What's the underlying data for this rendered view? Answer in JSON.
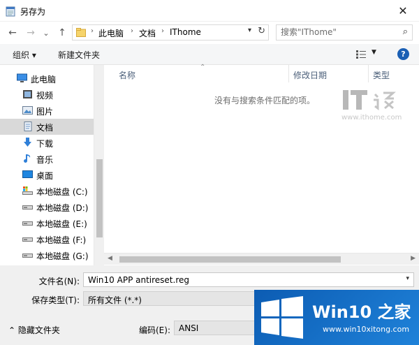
{
  "window": {
    "title": "另存为",
    "close_glyph": "✕"
  },
  "nav_buttons": {
    "back": "←",
    "forward": "→",
    "history": "⌄",
    "up": "↑"
  },
  "address": {
    "crumbs": [
      "此电脑",
      "文档",
      "IThome"
    ],
    "separator": "›",
    "refresh_glyph": "↻"
  },
  "search": {
    "placeholder": "搜索\"IThome\""
  },
  "toolbar": {
    "organize": "组织 ▾",
    "new_folder": "新建文件夹",
    "help": "?"
  },
  "nav_pane": {
    "items": [
      {
        "label": "此电脑",
        "icon": "computer-icon"
      },
      {
        "label": "视频",
        "icon": "video-icon"
      },
      {
        "label": "图片",
        "icon": "picture-icon"
      },
      {
        "label": "文档",
        "icon": "document-icon",
        "selected": true
      },
      {
        "label": "下载",
        "icon": "download-icon"
      },
      {
        "label": "音乐",
        "icon": "music-icon"
      },
      {
        "label": "桌面",
        "icon": "desktop-icon"
      },
      {
        "label": "本地磁盘 (C:)",
        "icon": "drive-icon"
      },
      {
        "label": "本地磁盘 (D:)",
        "icon": "drive-icon"
      },
      {
        "label": "本地磁盘 (E:)",
        "icon": "drive-icon"
      },
      {
        "label": "本地磁盘 (F:)",
        "icon": "drive-icon"
      },
      {
        "label": "本地磁盘 (G:)",
        "icon": "drive-icon"
      }
    ]
  },
  "file_list": {
    "columns": [
      "名称",
      "修改日期",
      "类型"
    ],
    "empty_message": "没有与搜索条件匹配的项。"
  },
  "watermark": {
    "ithome_url": "www.ithome.com"
  },
  "bottom": {
    "filename_label": "文件名(N):",
    "filename_value": "Win10 APP antireset.reg",
    "savetype_label": "保存类型(T):",
    "savetype_value": "所有文件  (*.*)",
    "encoding_label": "编码(E):",
    "encoding_value": "ANSI",
    "hide_folders": "隐藏文件夹"
  },
  "brand_logo": {
    "title": "Win10 之家",
    "subtitle": "www.win10xitong.com"
  },
  "colors": {
    "accent": "#1a5fb4",
    "selected_bg": "#d9d9d9",
    "logo_blue": "#0c5cb3"
  }
}
